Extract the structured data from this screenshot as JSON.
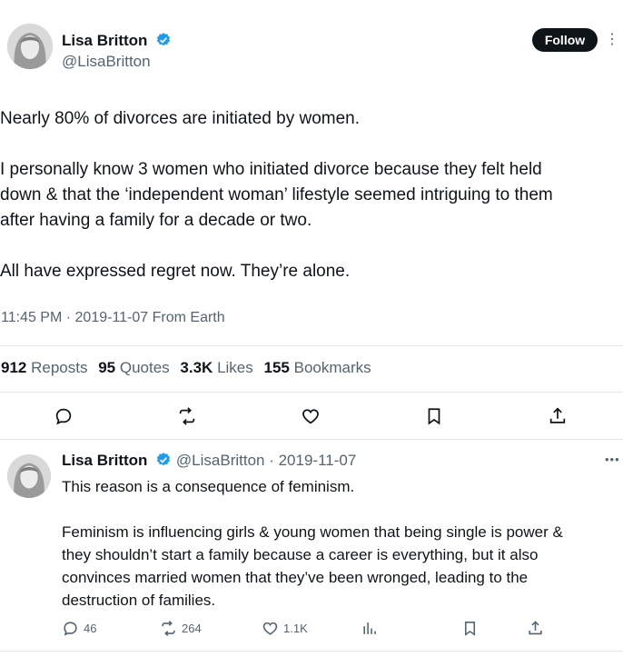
{
  "tweet": {
    "author_name": "Lisa Britton",
    "author_handle": "@LisaBritton",
    "follow_label": "Follow",
    "paragraphs": [
      "Nearly 80% of divorces are initiated by women.",
      "I personally know 3 women who initiated divorce because they felt held",
      "down & that the ‘independent woman’ lifestyle seemed intriguing to them",
      "after having a family for a decade or two.",
      "All have expressed regret now. They’re alone."
    ],
    "meta": "11:45 PM · 2019-11-07 From Earth",
    "stats": {
      "reposts_count": "912",
      "reposts_label": "Reposts",
      "quotes_count": "95",
      "quotes_label": "Quotes",
      "likes_count": "3.3K",
      "likes_label": "Likes",
      "bookmarks_count": "155",
      "bookmarks_label": "Bookmarks"
    }
  },
  "reply": {
    "author_name": "Lisa Britton",
    "handle_date": "@LisaBritton · 2019-11-07",
    "lines": [
      "This reason is a consequence of feminism.",
      "Feminism is influencing girls & young women that being single is power &",
      "they shouldn’t start a family because a career is everything, but it also",
      "convinces married women that they’ve been wronged, leading to the",
      "destruction of families."
    ],
    "actions": {
      "replies": "46",
      "reposts": "264",
      "likes": "1.1K"
    }
  },
  "colors": {
    "text": "#0f1419",
    "secondary": "#536471",
    "verified": "#1d9bf0",
    "divider": "#e6e9eb"
  },
  "icons": [
    "more-icon",
    "verified-icon",
    "reply-icon",
    "repost-icon",
    "like-icon",
    "bookmark-icon",
    "share-icon",
    "views-icon"
  ]
}
